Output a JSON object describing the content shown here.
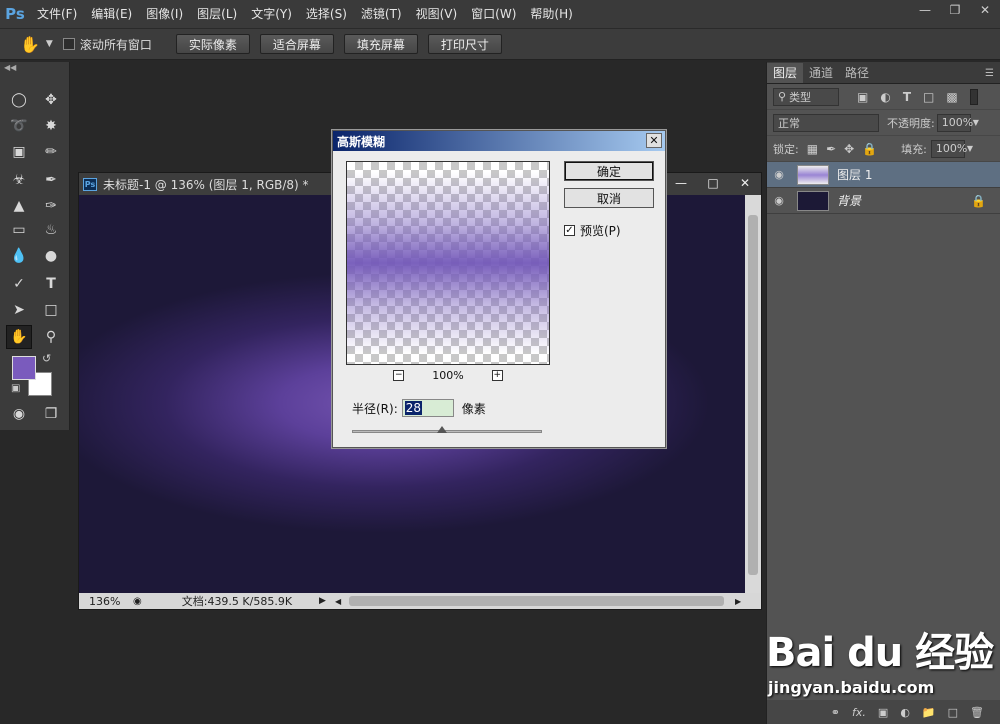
{
  "app": {
    "logo": "Ps"
  },
  "menu": [
    "文件(F)",
    "编辑(E)",
    "图像(I)",
    "图层(L)",
    "文字(Y)",
    "选择(S)",
    "滤镜(T)",
    "视图(V)",
    "窗口(W)",
    "帮助(H)"
  ],
  "options": {
    "scroll_all": "滚动所有窗口",
    "buttons": [
      "实际像素",
      "适合屏幕",
      "填充屏幕",
      "打印尺寸"
    ]
  },
  "document": {
    "title": "未标题-1 @ 136% (图层 1, RGB/8) *",
    "zoom": "136%",
    "doc_info": "文档:439.5 K/585.9K"
  },
  "panels": {
    "tabs": [
      "图层",
      "通道",
      "路径"
    ],
    "filter_kind": "类型",
    "blend_mode": "正常",
    "opacity_label": "不透明度:",
    "opacity_value": "100%",
    "lock_label": "锁定:",
    "fill_label": "填充:",
    "fill_value": "100%",
    "layers": [
      {
        "name": "图层 1"
      },
      {
        "name": "背景"
      }
    ],
    "bottom_fx": "fx."
  },
  "dialog": {
    "title": "高斯模糊",
    "ok": "确定",
    "cancel": "取消",
    "preview_label": "预览(P)",
    "zoom": "100%",
    "radius_label": "半径(R):",
    "radius_value": "28",
    "radius_unit": "像素"
  },
  "watermark": {
    "logo": "Bai du 经验",
    "url": "jingyan.baidu.com"
  },
  "colors": {
    "foreground": "#7a5bbd",
    "background": "#ffffff",
    "layer_thumb": "#1c1936"
  }
}
